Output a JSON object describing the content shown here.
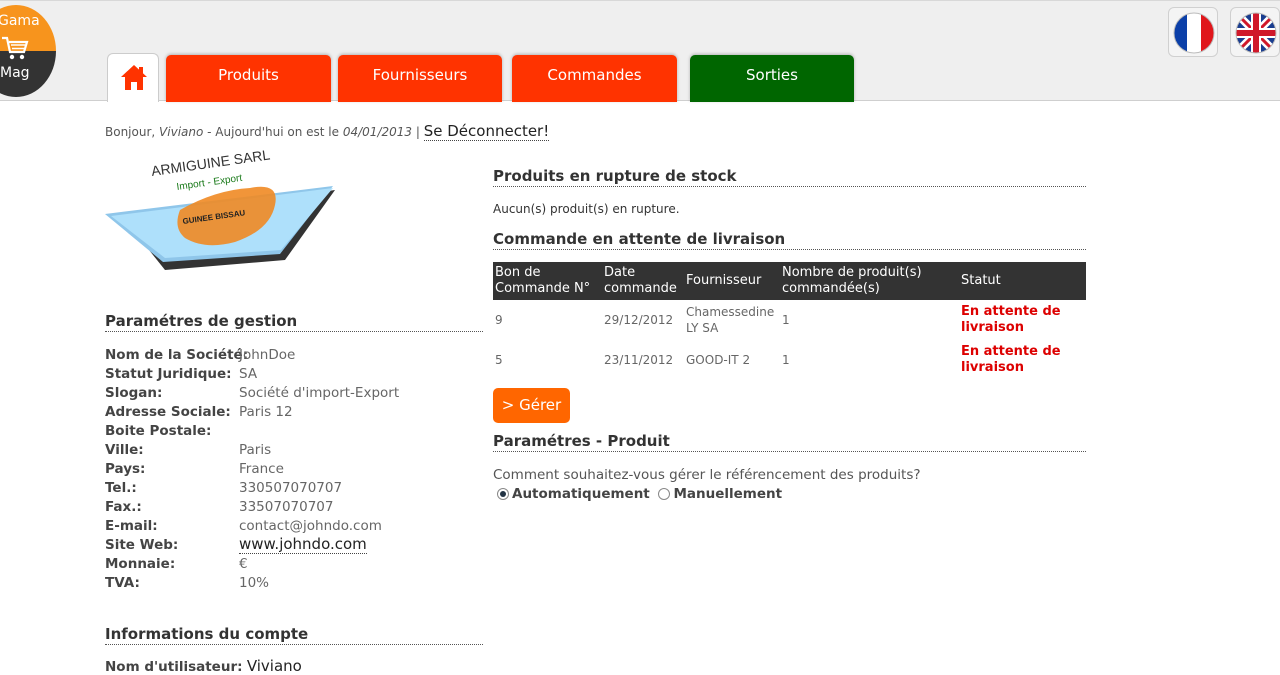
{
  "app": {
    "logo_line1": "Gama",
    "logo_line2": "Mag"
  },
  "nav": {
    "tabs": [
      {
        "label": "Produits"
      },
      {
        "label": "Fournisseurs"
      },
      {
        "label": "Commandes"
      },
      {
        "label": "Sorties"
      }
    ]
  },
  "greeting": {
    "hello": "Bonjour,",
    "user": "Viviano",
    "date_prefix": "- Aujourd'hui on est le",
    "date": "04/01/2013",
    "separator": "|",
    "logout": "Se Déconnecter!"
  },
  "company_logo": {
    "name": "ARMIGUINE SARL",
    "tagline": "Import - Export",
    "country": "GUINEE BISSAU"
  },
  "params": {
    "title": "Paramétres de gestion",
    "rows": [
      {
        "k": "Nom de la Société:",
        "v": "JohnDoe"
      },
      {
        "k": "Statut Juridique:",
        "v": "SA"
      },
      {
        "k": "Slogan:",
        "v": "Société d'import-Export"
      },
      {
        "k": "Adresse Sociale:",
        "v": "Paris 12"
      },
      {
        "k": "Boite Postale:",
        "v": ""
      },
      {
        "k": "Ville:",
        "v": "Paris"
      },
      {
        "k": "Pays:",
        "v": "France"
      },
      {
        "k": "Tel.:",
        "v": "330507070707"
      },
      {
        "k": "Fax.:",
        "v": "33507070707"
      },
      {
        "k": "E-mail:",
        "v": "contact@johndo.com"
      },
      {
        "k": "Site Web:",
        "v": "www.johndo.com"
      },
      {
        "k": "Monnaie:",
        "v": "€"
      },
      {
        "k": "TVA:",
        "v": "10%"
      }
    ]
  },
  "account": {
    "title": "Informations du compte",
    "user_label": "Nom d'utilisateur:",
    "user_value": "Viviano"
  },
  "stock": {
    "title": "Produits en rupture de stock",
    "message": "Aucun(s) produit(s) en rupture."
  },
  "orders": {
    "title": "Commande en attente de livraison",
    "headers": [
      "Bon de Commande N°",
      "Date commande",
      "Fournisseur",
      "Nombre de produit(s) commandée(s)",
      "Statut"
    ],
    "rows": [
      {
        "num": "9",
        "date": "29/12/2012",
        "supplier": "Chamessedine LY SA",
        "qty": "1",
        "status": "En attente de livraison"
      },
      {
        "num": "5",
        "date": "23/11/2012",
        "supplier": "GOOD-IT 2",
        "qty": "1",
        "status": "En attente de livraison"
      }
    ],
    "manage_button": "> Gérer"
  },
  "product_params": {
    "title": "Paramétres - Produit",
    "question": "Comment souhaitez-vous gérer le référencement des produits?",
    "option_auto": "Automatiquement",
    "option_manual": "Manuellement",
    "selected": "auto"
  },
  "colors": {
    "tab_red": "#ff3300",
    "tab_green": "#006600",
    "button": "#ff6600",
    "status_red": "#dd0000"
  }
}
